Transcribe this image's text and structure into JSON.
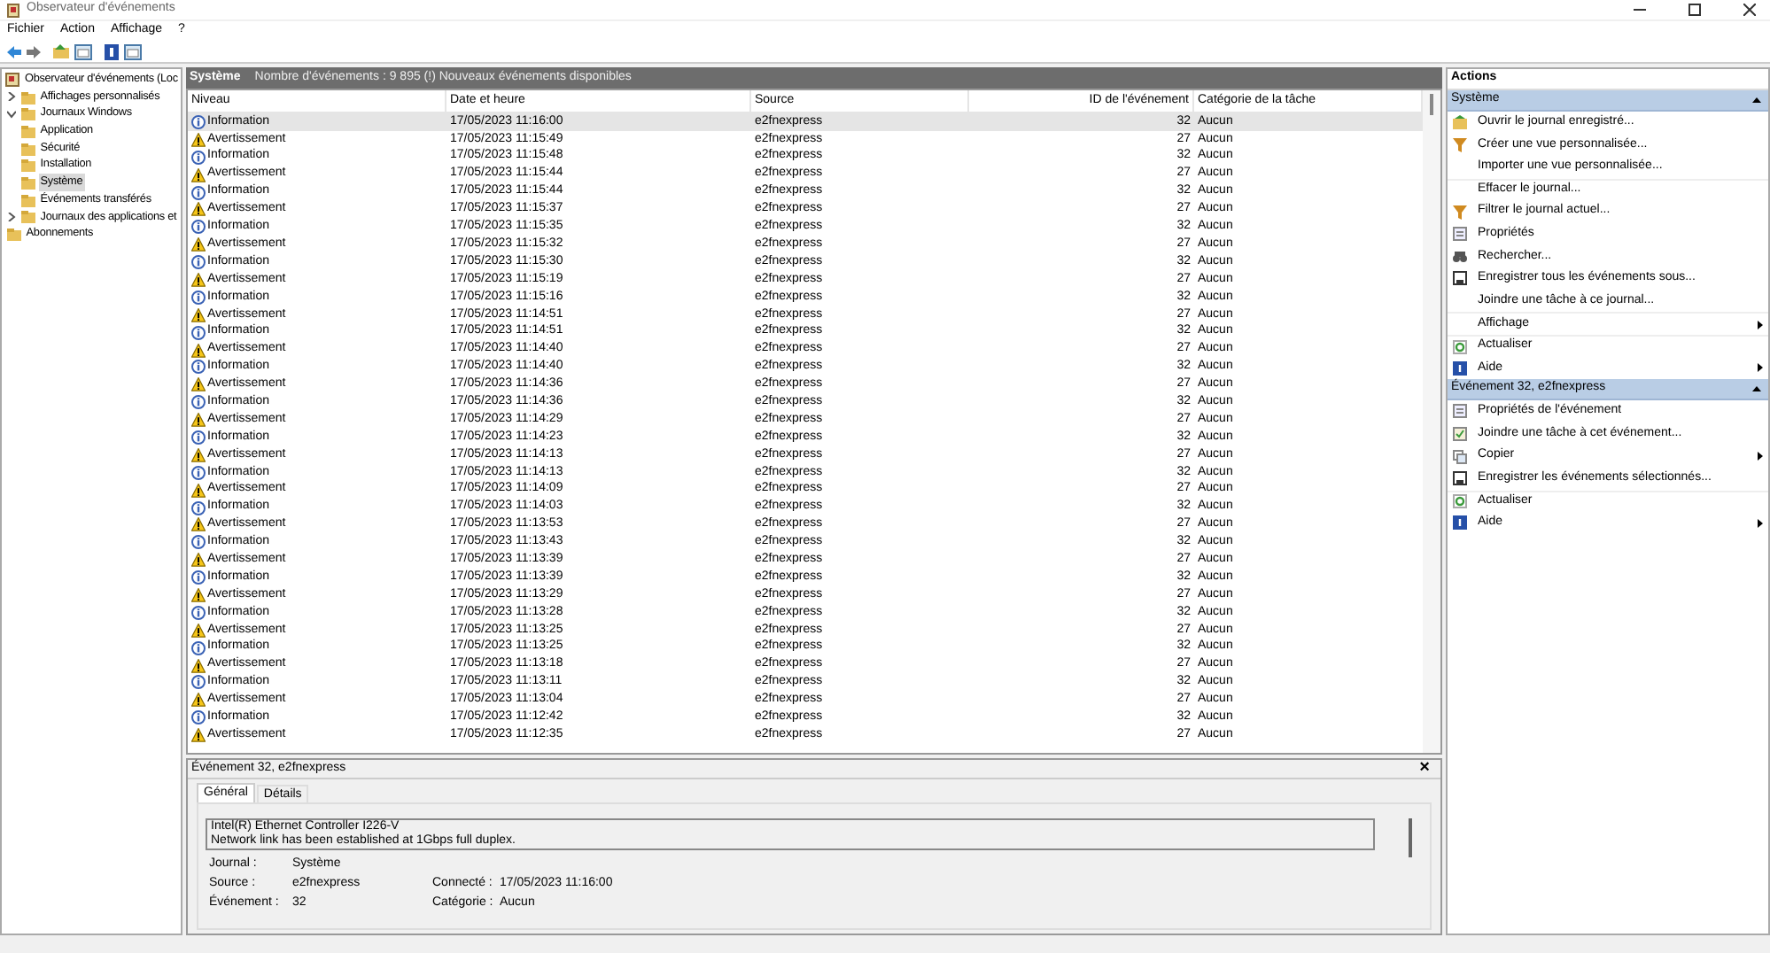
{
  "window": {
    "title": "Observateur d'événements"
  },
  "menu": [
    "Fichier",
    "Action",
    "Affichage",
    "?"
  ],
  "tree": [
    {
      "label": "Observateur d'événements (Loc",
      "selected": false,
      "children": [
        {
          "label": "Affichages personnalisés",
          "expanded": false,
          "selected": false
        },
        {
          "label": "Journaux Windows",
          "expanded": true,
          "selected": false,
          "children": [
            {
              "label": "Application",
              "selected": false
            },
            {
              "label": "Sécurité",
              "selected": false
            },
            {
              "label": "Installation",
              "selected": false
            },
            {
              "label": "Système",
              "selected": true
            },
            {
              "label": "Événements transférés",
              "selected": false
            }
          ]
        },
        {
          "label": "Journaux des applications et",
          "expanded": false,
          "selected": false
        },
        {
          "label": "Abonnements",
          "selected": false
        }
      ]
    }
  ],
  "log_header": {
    "title": "Système",
    "summary": "Nombre d'événements : 9 895 (!) Nouveaux événements disponibles"
  },
  "table": {
    "columns": [
      "Niveau",
      "Date et heure",
      "Source",
      "ID de l'événement",
      "Catégorie de la tâche"
    ],
    "rows": [
      {
        "kind": "info",
        "level_text": "Information",
        "date": "17/05/2023 11:16:00",
        "source": "e2fnexpress",
        "id": "32",
        "category": "Aucun",
        "selected": true
      },
      {
        "kind": "warning",
        "level_text": "Avertissement",
        "date": "17/05/2023 11:15:49",
        "source": "e2fnexpress",
        "id": "27",
        "category": "Aucun",
        "selected": false
      },
      {
        "kind": "info",
        "level_text": "Information",
        "date": "17/05/2023 11:15:48",
        "source": "e2fnexpress",
        "id": "32",
        "category": "Aucun",
        "selected": false
      },
      {
        "kind": "warning",
        "level_text": "Avertissement",
        "date": "17/05/2023 11:15:44",
        "source": "e2fnexpress",
        "id": "27",
        "category": "Aucun",
        "selected": false
      },
      {
        "kind": "info",
        "level_text": "Information",
        "date": "17/05/2023 11:15:44",
        "source": "e2fnexpress",
        "id": "32",
        "category": "Aucun",
        "selected": false
      },
      {
        "kind": "warning",
        "level_text": "Avertissement",
        "date": "17/05/2023 11:15:37",
        "source": "e2fnexpress",
        "id": "27",
        "category": "Aucun",
        "selected": false
      },
      {
        "kind": "info",
        "level_text": "Information",
        "date": "17/05/2023 11:15:35",
        "source": "e2fnexpress",
        "id": "32",
        "category": "Aucun",
        "selected": false
      },
      {
        "kind": "warning",
        "level_text": "Avertissement",
        "date": "17/05/2023 11:15:32",
        "source": "e2fnexpress",
        "id": "27",
        "category": "Aucun",
        "selected": false
      },
      {
        "kind": "info",
        "level_text": "Information",
        "date": "17/05/2023 11:15:30",
        "source": "e2fnexpress",
        "id": "32",
        "category": "Aucun",
        "selected": false
      },
      {
        "kind": "warning",
        "level_text": "Avertissement",
        "date": "17/05/2023 11:15:19",
        "source": "e2fnexpress",
        "id": "27",
        "category": "Aucun",
        "selected": false
      },
      {
        "kind": "info",
        "level_text": "Information",
        "date": "17/05/2023 11:15:16",
        "source": "e2fnexpress",
        "id": "32",
        "category": "Aucun",
        "selected": false
      },
      {
        "kind": "warning",
        "level_text": "Avertissement",
        "date": "17/05/2023 11:14:51",
        "source": "e2fnexpress",
        "id": "27",
        "category": "Aucun",
        "selected": false
      },
      {
        "kind": "info",
        "level_text": "Information",
        "date": "17/05/2023 11:14:51",
        "source": "e2fnexpress",
        "id": "32",
        "category": "Aucun",
        "selected": false
      },
      {
        "kind": "warning",
        "level_text": "Avertissement",
        "date": "17/05/2023 11:14:40",
        "source": "e2fnexpress",
        "id": "27",
        "category": "Aucun",
        "selected": false
      },
      {
        "kind": "info",
        "level_text": "Information",
        "date": "17/05/2023 11:14:40",
        "source": "e2fnexpress",
        "id": "32",
        "category": "Aucun",
        "selected": false
      },
      {
        "kind": "warning",
        "level_text": "Avertissement",
        "date": "17/05/2023 11:14:36",
        "source": "e2fnexpress",
        "id": "27",
        "category": "Aucun",
        "selected": false
      },
      {
        "kind": "info",
        "level_text": "Information",
        "date": "17/05/2023 11:14:36",
        "source": "e2fnexpress",
        "id": "32",
        "category": "Aucun",
        "selected": false
      },
      {
        "kind": "warning",
        "level_text": "Avertissement",
        "date": "17/05/2023 11:14:29",
        "source": "e2fnexpress",
        "id": "27",
        "category": "Aucun",
        "selected": false
      },
      {
        "kind": "info",
        "level_text": "Information",
        "date": "17/05/2023 11:14:23",
        "source": "e2fnexpress",
        "id": "32",
        "category": "Aucun",
        "selected": false
      },
      {
        "kind": "warning",
        "level_text": "Avertissement",
        "date": "17/05/2023 11:14:13",
        "source": "e2fnexpress",
        "id": "27",
        "category": "Aucun",
        "selected": false
      },
      {
        "kind": "info",
        "level_text": "Information",
        "date": "17/05/2023 11:14:13",
        "source": "e2fnexpress",
        "id": "32",
        "category": "Aucun",
        "selected": false
      },
      {
        "kind": "warning",
        "level_text": "Avertissement",
        "date": "17/05/2023 11:14:09",
        "source": "e2fnexpress",
        "id": "27",
        "category": "Aucun",
        "selected": false
      },
      {
        "kind": "info",
        "level_text": "Information",
        "date": "17/05/2023 11:14:03",
        "source": "e2fnexpress",
        "id": "32",
        "category": "Aucun",
        "selected": false
      },
      {
        "kind": "warning",
        "level_text": "Avertissement",
        "date": "17/05/2023 11:13:53",
        "source": "e2fnexpress",
        "id": "27",
        "category": "Aucun",
        "selected": false
      },
      {
        "kind": "info",
        "level_text": "Information",
        "date": "17/05/2023 11:13:43",
        "source": "e2fnexpress",
        "id": "32",
        "category": "Aucun",
        "selected": false
      },
      {
        "kind": "warning",
        "level_text": "Avertissement",
        "date": "17/05/2023 11:13:39",
        "source": "e2fnexpress",
        "id": "27",
        "category": "Aucun",
        "selected": false
      },
      {
        "kind": "info",
        "level_text": "Information",
        "date": "17/05/2023 11:13:39",
        "source": "e2fnexpress",
        "id": "32",
        "category": "Aucun",
        "selected": false
      },
      {
        "kind": "warning",
        "level_text": "Avertissement",
        "date": "17/05/2023 11:13:29",
        "source": "e2fnexpress",
        "id": "27",
        "category": "Aucun",
        "selected": false
      },
      {
        "kind": "info",
        "level_text": "Information",
        "date": "17/05/2023 11:13:28",
        "source": "e2fnexpress",
        "id": "32",
        "category": "Aucun",
        "selected": false
      },
      {
        "kind": "warning",
        "level_text": "Avertissement",
        "date": "17/05/2023 11:13:25",
        "source": "e2fnexpress",
        "id": "27",
        "category": "Aucun",
        "selected": false
      },
      {
        "kind": "info",
        "level_text": "Information",
        "date": "17/05/2023 11:13:25",
        "source": "e2fnexpress",
        "id": "32",
        "category": "Aucun",
        "selected": false
      },
      {
        "kind": "warning",
        "level_text": "Avertissement",
        "date": "17/05/2023 11:13:18",
        "source": "e2fnexpress",
        "id": "27",
        "category": "Aucun",
        "selected": false
      },
      {
        "kind": "info",
        "level_text": "Information",
        "date": "17/05/2023 11:13:11",
        "source": "e2fnexpress",
        "id": "32",
        "category": "Aucun",
        "selected": false
      },
      {
        "kind": "warning",
        "level_text": "Avertissement",
        "date": "17/05/2023 11:13:04",
        "source": "e2fnexpress",
        "id": "27",
        "category": "Aucun",
        "selected": false
      },
      {
        "kind": "info",
        "level_text": "Information",
        "date": "17/05/2023 11:12:42",
        "source": "e2fnexpress",
        "id": "32",
        "category": "Aucun",
        "selected": false
      },
      {
        "kind": "warning",
        "level_text": "Avertissement",
        "date": "17/05/2023 11:12:35",
        "source": "e2fnexpress",
        "id": "27",
        "category": "Aucun",
        "selected": false
      }
    ]
  },
  "details": {
    "title": "Événement 32, e2fnexpress",
    "close": "×",
    "tabs": [
      {
        "label": "Général",
        "selected": true
      },
      {
        "label": "Détails",
        "selected": false
      }
    ],
    "message": [
      "Intel(R) Ethernet Controller I226-V",
      "Network link has been established at 1Gbps full duplex."
    ],
    "fields": [
      {
        "label": "Journal :",
        "value": "Système"
      },
      {
        "label": "Source :",
        "value": "e2fnexpress",
        "label2": "Connecté :",
        "value2": "17/05/2023 11:16:00"
      },
      {
        "label": "Événement :",
        "value": "32",
        "label2": "Catégorie :",
        "value2": "Aucun"
      }
    ]
  },
  "actions": {
    "title": "Actions",
    "sections": [
      {
        "title": "Système",
        "items": [
          {
            "label": "Ouvrir le journal enregistré...",
            "kind": "open"
          },
          {
            "label": "Créer une vue personnalisée...",
            "kind": "filter"
          },
          {
            "label": "Importer une vue personnalisée...",
            "kind": "plain"
          },
          {
            "label": "Effacer le journal...",
            "kind": "plain"
          },
          {
            "label": "Filtrer le journal actuel...",
            "kind": "filter"
          },
          {
            "label": "Propriétés",
            "kind": "props"
          },
          {
            "label": "Rechercher...",
            "kind": "find"
          },
          {
            "label": "Enregistrer tous les événements sous...",
            "kind": "save"
          },
          {
            "label": "Joindre une tâche à ce journal...",
            "kind": "plain"
          },
          {
            "label": "Affichage",
            "kind": "plain",
            "submenu": true
          },
          {
            "label": "Actualiser",
            "kind": "refresh"
          },
          {
            "label": "Aide",
            "kind": "help",
            "submenu": true
          }
        ]
      },
      {
        "title": "Événement 32, e2fnexpress",
        "items": [
          {
            "label": "Propriétés de l'événement",
            "kind": "props"
          },
          {
            "label": "Joindre une tâche à cet événement...",
            "kind": "task"
          },
          {
            "label": "Copier",
            "kind": "copy",
            "submenu": true
          },
          {
            "label": "Enregistrer les événements sélectionnés...",
            "kind": "save"
          },
          {
            "label": "Actualiser",
            "kind": "refresh"
          },
          {
            "label": "Aide",
            "kind": "help",
            "submenu": true
          }
        ]
      }
    ]
  }
}
